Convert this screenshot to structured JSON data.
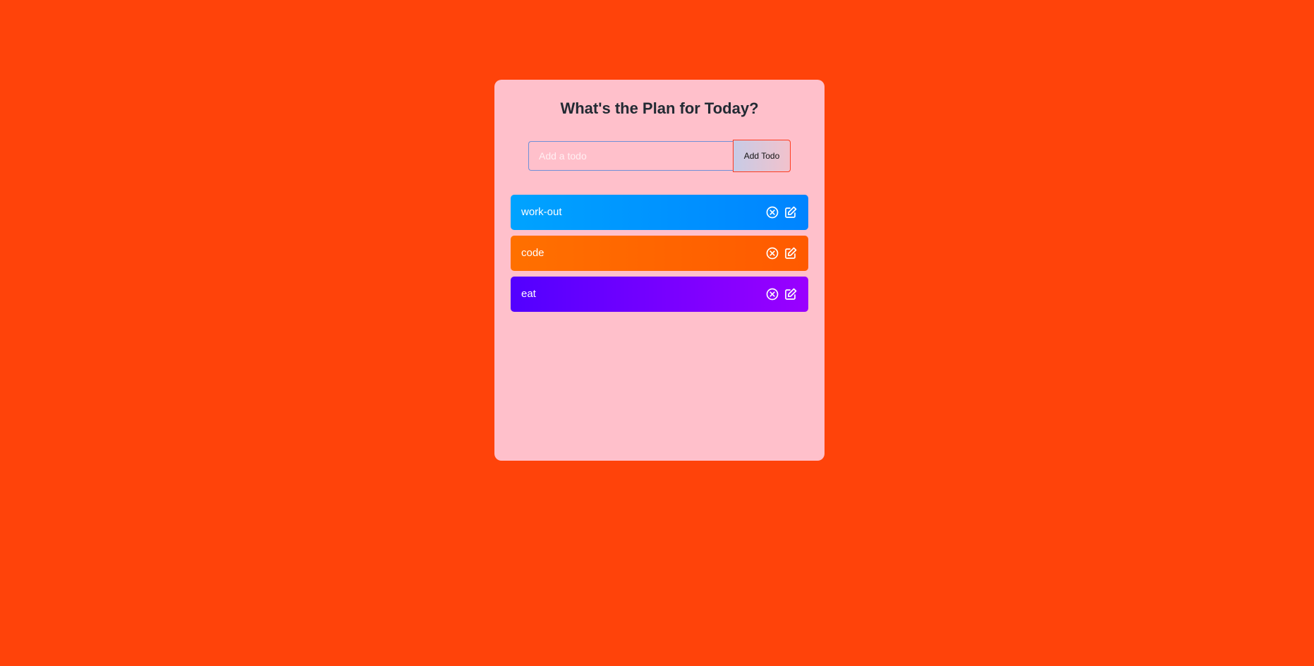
{
  "app": {
    "title": "What's the Plan for Today?"
  },
  "form": {
    "input_value": "",
    "placeholder": "Add a todo",
    "button_label": "Add Todo"
  },
  "todos": [
    {
      "text": "work-out",
      "color": "#0095ff",
      "delete_icon": "close-circle-icon",
      "edit_icon": "edit-icon"
    },
    {
      "text": "code",
      "color": "#ff6a00",
      "delete_icon": "close-circle-icon",
      "edit_icon": "edit-icon"
    },
    {
      "text": "eat",
      "color": "#7b00ff",
      "delete_icon": "close-circle-icon",
      "edit_icon": "edit-icon"
    }
  ],
  "colors": {
    "page_background": "#ff430a",
    "card_background": "#ffc0cb"
  }
}
